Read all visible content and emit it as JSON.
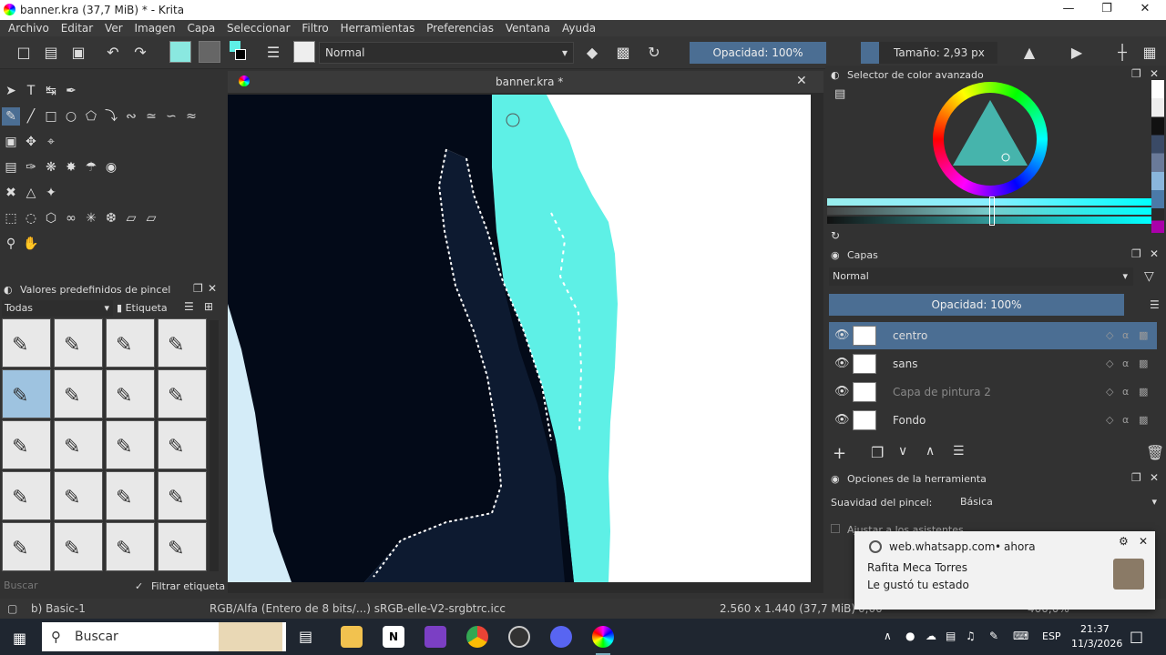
{
  "window": {
    "title": "banner.kra (37,7 MiB)  * - Krita"
  },
  "menu": [
    "Archivo",
    "Editar",
    "Ver",
    "Imagen",
    "Capa",
    "Seleccionar",
    "Filtro",
    "Herramientas",
    "Preferencias",
    "Ventana",
    "Ayuda"
  ],
  "toolbar": {
    "blend_mode": "Normal",
    "opacity": "Opacidad: 100%",
    "size": "Tamaño: 2,93 px"
  },
  "brush_presets": {
    "title": "Valores predefinidos de pincel",
    "tag_filter": "Todas",
    "tag_button": "Etiqueta",
    "search_placeholder": "Buscar",
    "filter_tag_label": "Filtrar etiqueta"
  },
  "canvas": {
    "tab_title": "banner.kra *"
  },
  "color_selector": {
    "title": "Selector de color avanzado"
  },
  "layers": {
    "title": "Capas",
    "blend_mode": "Normal",
    "opacity": "Opacidad:  100%",
    "items": [
      {
        "name": "centro",
        "selected": true
      },
      {
        "name": "sans",
        "selected": false
      },
      {
        "name": "Capa de pintura 2",
        "selected": false
      },
      {
        "name": "Fondo",
        "selected": false
      }
    ]
  },
  "tool_options": {
    "title": "Opciones de la herramienta",
    "smoothing_label": "Suavidad del pincel:",
    "smoothing_value": "Básica",
    "assistants_label": "Ajustar a los asistentes"
  },
  "status": {
    "brush": "b) Basic-1",
    "color_model": "RGB/Alfa (Entero de 8 bits/...)  sRGB-elle-V2-srgbtrc.icc",
    "dimensions": "2.560 x 1.440 (37,7 MiB)",
    "rotation": "0,00",
    "zoom": "400,0%"
  },
  "notification": {
    "source": "web.whatsapp.com",
    "time": "ahora",
    "sender": "Rafita Meca Torres",
    "message": "Le gustó tu estado"
  },
  "taskbar": {
    "search_placeholder": "Buscar",
    "time": "21:37",
    "date": "11/3/2026",
    "language": "ESP"
  },
  "colors": {
    "accent": "#4b6e93",
    "cyan_paint": "#5ef0e6",
    "dark_paint": "#030a18",
    "navy_paint": "#0d1a30",
    "light_blue_paint": "#8ab6dc"
  }
}
